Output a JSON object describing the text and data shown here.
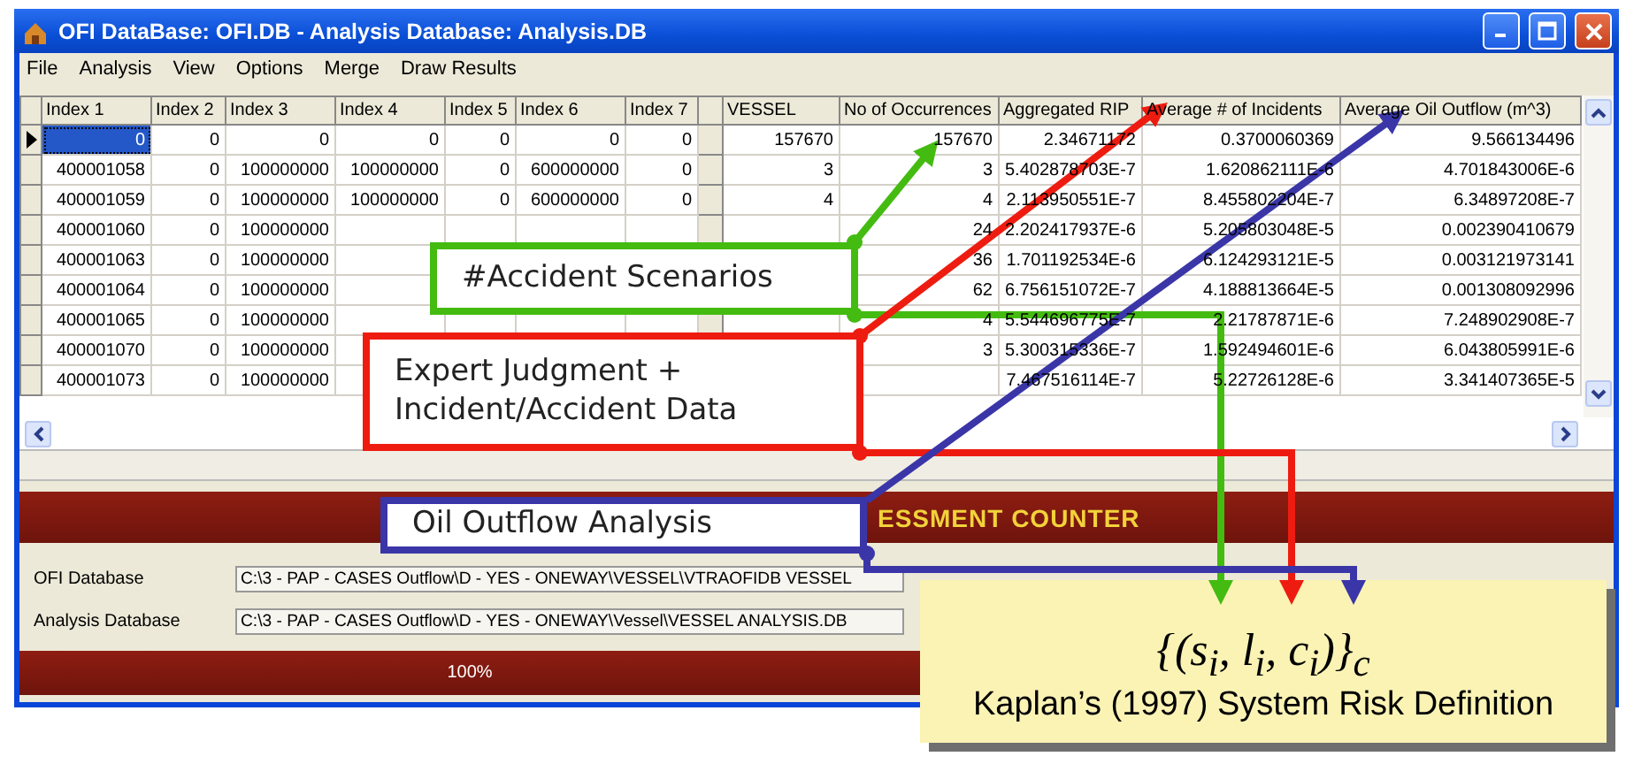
{
  "window": {
    "title": "OFI DataBase: OFI.DB - Analysis Database: Analysis.DB"
  },
  "menu": [
    "File",
    "Analysis",
    "View",
    "Options",
    "Merge",
    "Draw Results"
  ],
  "table": {
    "columns": [
      "Index 1",
      "Index 2",
      "Index 3",
      "Index 4",
      "Index 5",
      "Index 6",
      "Index 7",
      "VESSEL",
      "No of Occurrences",
      "Aggregated RIP",
      "Average # of Incidents",
      "Average Oil Outflow (m^3)"
    ],
    "rows": [
      {
        "selected": true,
        "cells": [
          "0",
          "0",
          "0",
          "0",
          "0",
          "0",
          "0",
          "157670",
          "157670",
          "2.34671172",
          "0.3700060369",
          "9.566134496"
        ]
      },
      {
        "selected": false,
        "cells": [
          "400001058",
          "0",
          "100000000",
          "100000000",
          "0",
          "600000000",
          "0",
          "3",
          "3",
          "5.402878703E-7",
          "1.620862111E-6",
          "4.701843006E-6"
        ]
      },
      {
        "selected": false,
        "cells": [
          "400001059",
          "0",
          "100000000",
          "100000000",
          "0",
          "600000000",
          "0",
          "4",
          "4",
          "2.113950551E-7",
          "8.455802204E-7",
          "6.34897208E-7"
        ]
      },
      {
        "selected": false,
        "cells": [
          "400001060",
          "0",
          "100000000",
          null,
          null,
          null,
          null,
          null,
          "24",
          "2.202417937E-6",
          "5.205803048E-5",
          "0.002390410679"
        ]
      },
      {
        "selected": false,
        "cells": [
          "400001063",
          "0",
          "100000000",
          null,
          null,
          null,
          null,
          null,
          "36",
          "1.701192534E-6",
          "6.124293121E-5",
          "0.003121973141"
        ]
      },
      {
        "selected": false,
        "cells": [
          "400001064",
          "0",
          "100000000",
          null,
          null,
          null,
          null,
          null,
          "62",
          "6.756151072E-7",
          "4.188813664E-5",
          "0.001308092996"
        ]
      },
      {
        "selected": false,
        "cells": [
          "400001065",
          "0",
          "100000000",
          null,
          null,
          null,
          null,
          null,
          "4",
          "5.544696775E-7",
          "2.21787871E-6",
          "7.248902908E-7"
        ]
      },
      {
        "selected": false,
        "cells": [
          "400001070",
          "0",
          "100000000",
          null,
          null,
          null,
          null,
          null,
          "3",
          "5.300315336E-7",
          "1.592494601E-6",
          "6.043805991E-6"
        ]
      },
      {
        "selected": false,
        "cells": [
          "400001073",
          "0",
          "100000000",
          null,
          null,
          null,
          null,
          null,
          null,
          "7.467516114E-7",
          "5.22726128E-6",
          "3.341407365E-5"
        ]
      }
    ]
  },
  "banner": {
    "text": "ESSMENT COUNTER"
  },
  "fields": [
    {
      "label": "OFI Database",
      "value": "C:\\3 - PAP - CASES Outflow\\D - YES - ONEWAY\\VESSEL\\VTRAOFIDB  VESSEL"
    },
    {
      "label": "Analysis Database",
      "value": "C:\\3 - PAP - CASES Outflow\\D - YES - ONEWAY\\Vessel\\VESSEL ANALYSIS.DB"
    }
  ],
  "progress": {
    "text": "100%"
  },
  "callouts": [
    {
      "text": "#Accident Scenarios",
      "color": "#44bb11"
    },
    {
      "text": "Expert Judgment + Incident/Accident Data",
      "color": "#ee1c10"
    },
    {
      "text": "Oil Outflow Analysis",
      "color": "#3a36a8"
    }
  ],
  "definition": {
    "formula": "{(s$_{i}$, l$_{i}$, c$_{i}$)}$_{c}$",
    "caption": "Kaplan’s (1997) System Risk Definition"
  }
}
